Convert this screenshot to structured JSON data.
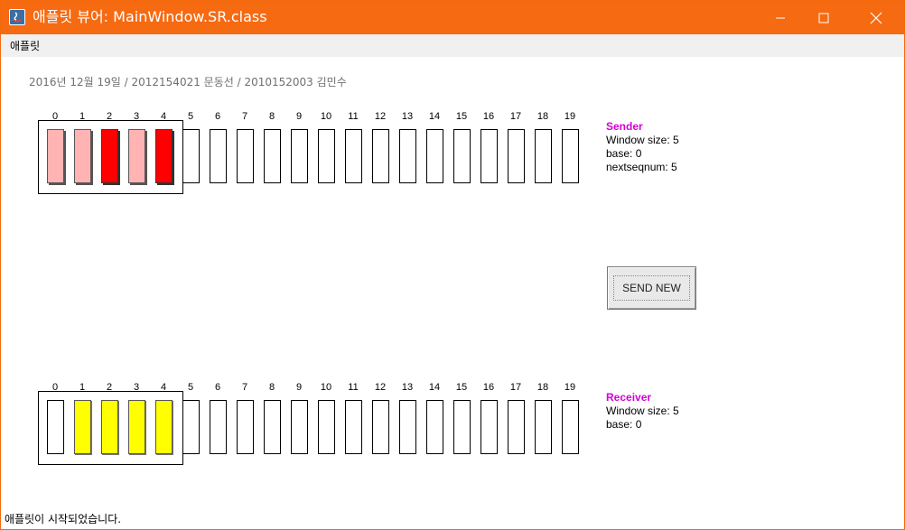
{
  "window": {
    "title": "애플릿 뷰어: MainWindow.SR.class",
    "icon": "java-icon",
    "buttons": [
      "minimize-icon",
      "maximize-icon",
      "close-icon"
    ]
  },
  "menubar": {
    "applet_menu": "애플릿"
  },
  "header": {
    "info_line": "2016년 12월 19일 / 2012154021 문동선 / 2010152003 김민수"
  },
  "sender": {
    "indices": [
      "0",
      "1",
      "2",
      "3",
      "4",
      "5",
      "6",
      "7",
      "8",
      "9",
      "10",
      "11",
      "12",
      "13",
      "14",
      "15",
      "16",
      "17",
      "18",
      "19"
    ],
    "cell_states": [
      "acked",
      "acked",
      "sent",
      "acked",
      "sent",
      "empty",
      "empty",
      "empty",
      "empty",
      "empty",
      "empty",
      "empty",
      "empty",
      "empty",
      "empty",
      "empty",
      "empty",
      "empty",
      "empty",
      "empty"
    ],
    "title": "Sender",
    "window_size": "Window size: 5",
    "base": "base: 0",
    "nextseqnum": "nextseqnum: 5"
  },
  "receiver": {
    "indices": [
      "0",
      "1",
      "2",
      "3",
      "4",
      "5",
      "6",
      "7",
      "8",
      "9",
      "10",
      "11",
      "12",
      "13",
      "14",
      "15",
      "16",
      "17",
      "18",
      "19"
    ],
    "cell_states": [
      "empty",
      "buffered",
      "buffered",
      "buffered",
      "buffered",
      "empty",
      "empty",
      "empty",
      "empty",
      "empty",
      "empty",
      "empty",
      "empty",
      "empty",
      "empty",
      "empty",
      "empty",
      "empty",
      "empty",
      "empty"
    ],
    "title": "Receiver",
    "window_size": "Window size: 5",
    "base": "base: 0"
  },
  "controls": {
    "send_new_label": "SEND NEW"
  },
  "status_bar": {
    "text": "애플릿이 시작되었습니다."
  },
  "colors": {
    "titlebar": "#f66a12",
    "acked": "#ffb3b3",
    "sent": "#ff0000",
    "buffered": "#ffff00",
    "label_accent": "#d400d4"
  }
}
